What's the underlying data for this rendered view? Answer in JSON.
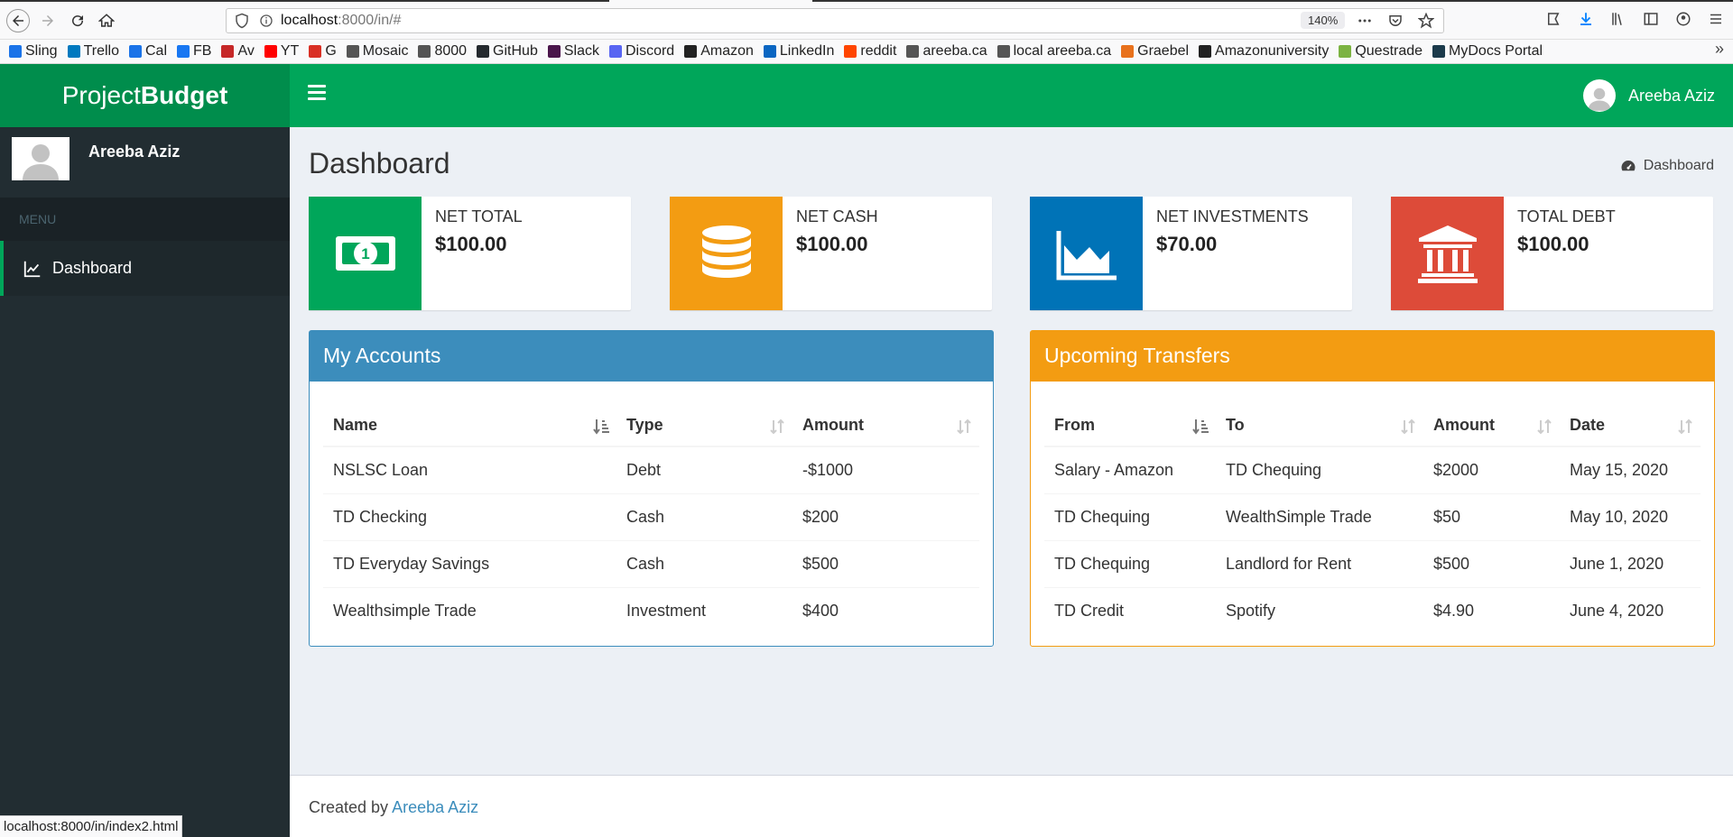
{
  "browser": {
    "url_host": "localhost",
    "url_path": ":8000/in/#",
    "zoom": "140%",
    "status_url": "localhost:8000/in/index2.html",
    "bookmarks": [
      {
        "label": "Sling",
        "color": "#1a73e8"
      },
      {
        "label": "Trello",
        "color": "#0079bf"
      },
      {
        "label": "Cal",
        "color": "#1a73e8"
      },
      {
        "label": "FB",
        "color": "#1877f2"
      },
      {
        "label": "Av",
        "color": "#c62828"
      },
      {
        "label": "YT",
        "color": "#ff0000"
      },
      {
        "label": "G",
        "color": "#d93025"
      },
      {
        "label": "Mosaic",
        "color": "#555555"
      },
      {
        "label": "8000",
        "color": "#555555"
      },
      {
        "label": "GitHub",
        "color": "#24292e"
      },
      {
        "label": "Slack",
        "color": "#4a154b"
      },
      {
        "label": "Discord",
        "color": "#5865f2"
      },
      {
        "label": "Amazon",
        "color": "#222222"
      },
      {
        "label": "LinkedIn",
        "color": "#0a66c2"
      },
      {
        "label": "reddit",
        "color": "#ff4500"
      },
      {
        "label": "areeba.ca",
        "color": "#555555"
      },
      {
        "label": "local areeba.ca",
        "color": "#555555"
      },
      {
        "label": "Graebel",
        "color": "#e8711c"
      },
      {
        "label": "Amazonuniversity",
        "color": "#222222"
      },
      {
        "label": "Questrade",
        "color": "#7cb342"
      },
      {
        "label": "MyDocs Portal",
        "color": "#1b3a4b"
      }
    ]
  },
  "app": {
    "logo_light": "Project",
    "logo_bold": "Budget",
    "user_name": "Areeba Aziz",
    "menu_header": "MENU",
    "menu_items": [
      {
        "label": "Dashboard",
        "icon": "line-chart-icon"
      }
    ],
    "page_title": "Dashboard",
    "breadcrumb": "Dashboard",
    "colors": {
      "green": "#00a65a",
      "dark_green": "#008d4c",
      "orange": "#f39c12",
      "blue": "#0073b7",
      "red": "#dd4b39",
      "light_blue": "#3c8dbc",
      "sidebar": "#222d32"
    }
  },
  "stats": [
    {
      "label": "NET TOTAL",
      "value": "$100.00",
      "icon": "money-bill-icon",
      "color": "#00a65a"
    },
    {
      "label": "NET CASH",
      "value": "$100.00",
      "icon": "database-icon",
      "color": "#f39c12"
    },
    {
      "label": "NET INVESTMENTS",
      "value": "$70.00",
      "icon": "area-chart-icon",
      "color": "#0073b7"
    },
    {
      "label": "TOTAL DEBT",
      "value": "$100.00",
      "icon": "bank-icon",
      "color": "#dd4b39"
    }
  ],
  "accounts": {
    "title": "My Accounts",
    "columns": [
      "Name",
      "Type",
      "Amount"
    ],
    "rows": [
      [
        "NSLSC Loan",
        "Debt",
        "-$1000"
      ],
      [
        "TD Checking",
        "Cash",
        "$200"
      ],
      [
        "TD Everyday Savings",
        "Cash",
        "$500"
      ],
      [
        "Wealthsimple Trade",
        "Investment",
        "$400"
      ]
    ]
  },
  "transfers": {
    "title": "Upcoming Transfers",
    "columns": [
      "From",
      "To",
      "Amount",
      "Date"
    ],
    "rows": [
      [
        "Salary - Amazon",
        "TD Chequing",
        "$2000",
        "May 15, 2020"
      ],
      [
        "TD Chequing",
        "WealthSimple Trade",
        "$50",
        "May 10, 2020"
      ],
      [
        "TD Chequing",
        "Landlord for Rent",
        "$500",
        "June 1, 2020"
      ],
      [
        "TD Credit",
        "Spotify",
        "$4.90",
        "June 4, 2020"
      ]
    ]
  },
  "footer": {
    "prefix": "Created by ",
    "author": "Areeba Aziz"
  }
}
